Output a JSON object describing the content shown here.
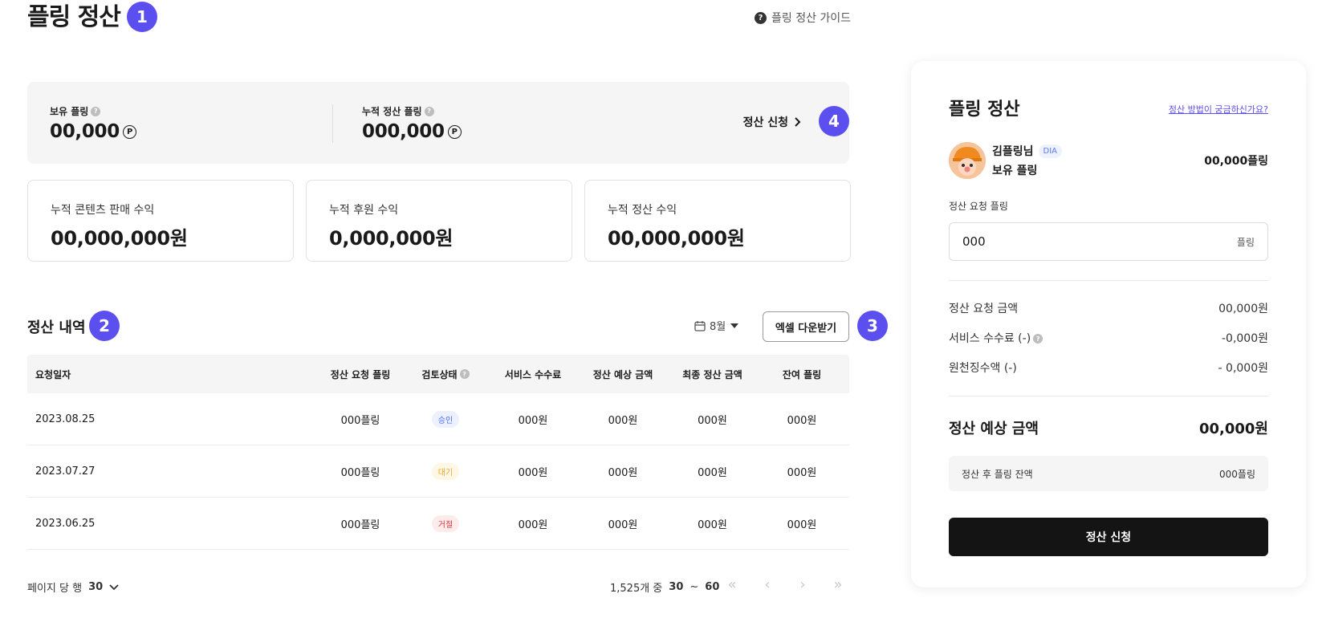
{
  "header": {
    "title": "플링 정산",
    "step": "1",
    "guide_label": "플링 정산 가이드"
  },
  "summary": {
    "holding_label": "보유 플링",
    "holding_value": "00,000",
    "accum_label": "누적 정산 플링",
    "accum_value": "000,000",
    "currency_symbol": "P",
    "apply_label": "정산 신청",
    "step": "4"
  },
  "stats": [
    {
      "label": "누적 콘텐츠 판매 수익",
      "value": "00,000,000원"
    },
    {
      "label": "누적 후원 수익",
      "value": "0,000,000원"
    },
    {
      "label": "누적 정산 수익",
      "value": "00,000,000원"
    }
  ],
  "history": {
    "title": "정산 내역",
    "step": "2",
    "month": "8월",
    "excel_label": "엑셀 다운받기",
    "excel_step": "3",
    "columns": [
      "요청일자",
      "정산 요청 플링",
      "검토상태",
      "서비스 수수료",
      "정산 예상 금액",
      "최종 정산 금액",
      "잔여 플링"
    ],
    "rows": [
      {
        "date": "2023.08.25",
        "req": "000플링",
        "status": "승인",
        "fee": "000원",
        "expected": "000원",
        "final": "000원",
        "remain": "000원"
      },
      {
        "date": "2023.07.27",
        "req": "000플링",
        "status": "대기",
        "fee": "000원",
        "expected": "000원",
        "final": "000원",
        "remain": "000원"
      },
      {
        "date": "2023.06.25",
        "req": "000플링",
        "status": "거절",
        "fee": "000원",
        "expected": "000원",
        "final": "000원",
        "remain": "000원"
      }
    ],
    "status_colors": {
      "승인": "#4a6cf7",
      "대기": "#f0a830",
      "거절": "#e0353d"
    }
  },
  "pagination": {
    "per_page_label": "페이지 당 행",
    "per_page_value": "30",
    "total_label": "1,525개 중",
    "range_from": "30",
    "range_sep": "~",
    "range_to": "60"
  },
  "panel": {
    "title": "플링 정산",
    "help_link": "정산 방법이 궁금하신가요?",
    "user_name": "김플링님",
    "user_tier": "DIA",
    "user_sub": "보유 플링",
    "user_balance": "00,000플링",
    "request_label": "정산 요청 플링",
    "request_value": "000",
    "request_unit": "플링",
    "rows": [
      {
        "label": "정산 요청 금액",
        "value": "00,000원"
      },
      {
        "label": "서비스 수수료 (-)",
        "value": "-0,000원"
      },
      {
        "label": "원천징수액 (-)",
        "value": "- 0,000원"
      }
    ],
    "total_label": "정산 예상 금액",
    "total_value": "00,000원",
    "remain_label": "정산 후 플링 잔액",
    "remain_value": "000플링",
    "submit_label": "정산 신청"
  },
  "colors": {
    "accent": "#5b4ff0"
  }
}
